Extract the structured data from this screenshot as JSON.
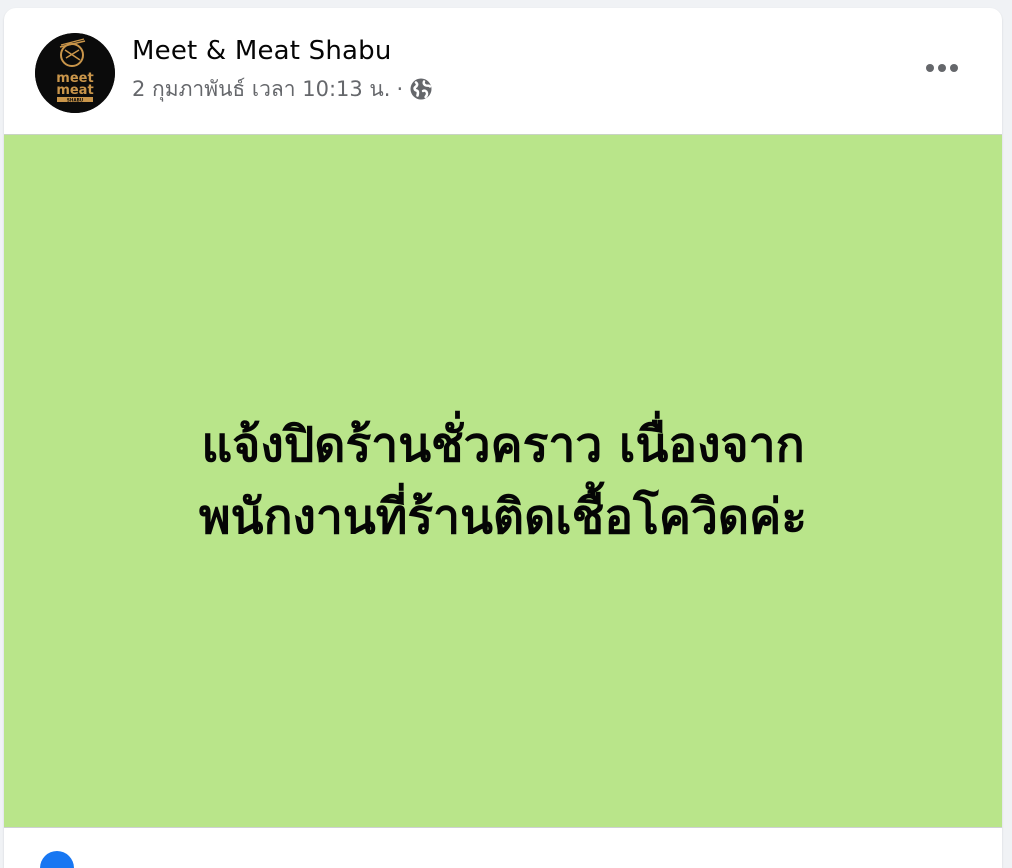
{
  "post": {
    "page_name": "Meet & Meat Shabu",
    "timestamp": "2 กุมภาพันธ์ เวลา 10:13 น.",
    "separator": "·",
    "privacy_icon": "globe-icon",
    "more_icon": "more-horizontal-icon",
    "avatar": {
      "logo_text_line1": "meet",
      "logo_text_line2": "meat",
      "logo_subtext": "SHABU"
    },
    "body": {
      "background_color": "#b9e58a",
      "text_line1": "แจ้งปิดร้านชั่วคราว เนื่องจาก",
      "text_line2": "พนักงานที่ร้านติดเชื้อโควิดค่ะ"
    },
    "reaction_icon": "like-reaction-icon"
  },
  "colors": {
    "card_bg": "#ffffff",
    "page_bg": "#f0f2f5",
    "meta_text": "#65676b",
    "primary_text": "#050505",
    "logo_gold": "#c9954a"
  }
}
